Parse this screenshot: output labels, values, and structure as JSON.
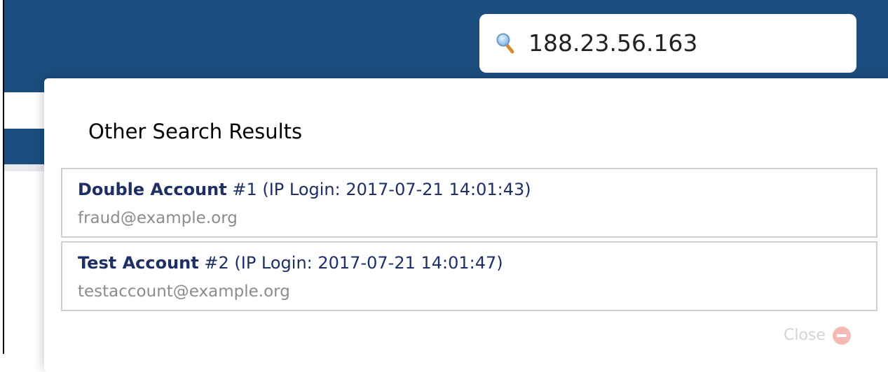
{
  "search": {
    "value": "188.23.56.163",
    "icon": "search-icon"
  },
  "results_panel": {
    "title": "Other Search Results",
    "results": [
      {
        "name": "Double Account",
        "detail": " #1 (IP Login: 2017-07-21 14:01:43)",
        "email": "fraud@example.org"
      },
      {
        "name": "Test Account",
        "detail": " #2 (IP Login: 2017-07-21 14:01:47)",
        "email": "testaccount@example.org"
      }
    ],
    "close_label": "Close",
    "close_icon": "close-icon"
  },
  "colors": {
    "header": "#1b4e7f",
    "link": "#1e2f66",
    "email": "#8c8c8c",
    "close_icon": "#f5b9b6"
  }
}
